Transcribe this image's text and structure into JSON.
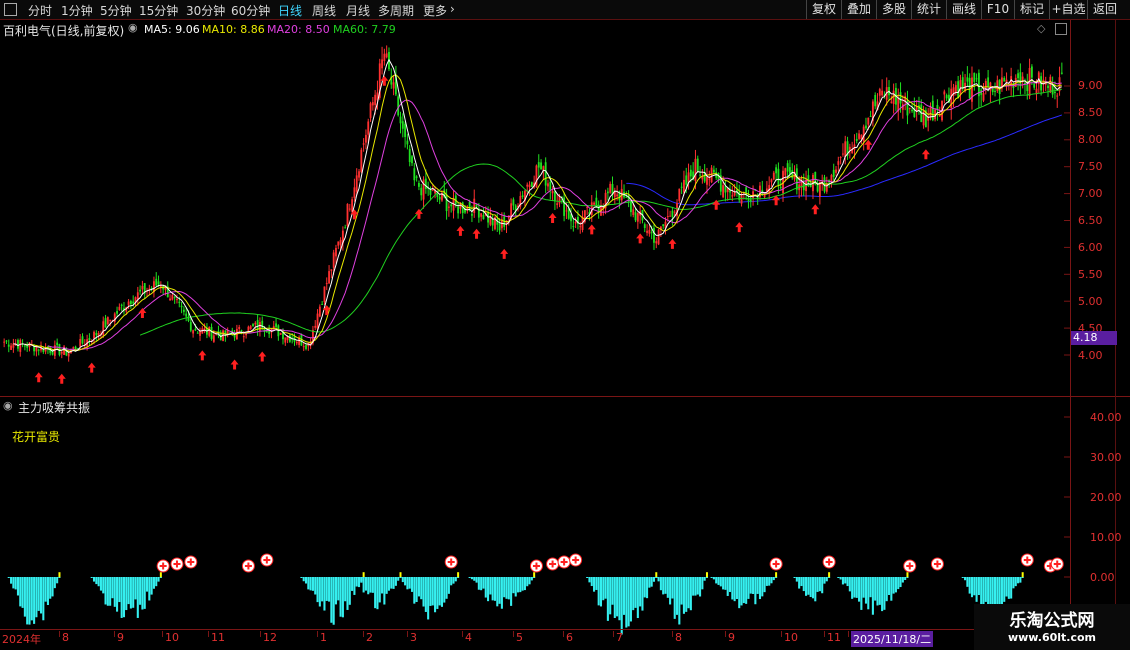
{
  "toolbar": {
    "periods": [
      "分时",
      "1分钟",
      "5分钟",
      "15分钟",
      "30分钟",
      "60分钟",
      "日线",
      "周线",
      "月线",
      "多周期",
      "更多"
    ],
    "active_period": "日线",
    "right_buttons": [
      "复权",
      "叠加",
      "多股",
      "统计",
      "画线",
      "F10",
      "标记",
      "+自选",
      "返回"
    ]
  },
  "main_chart": {
    "stock_title": "百利电气(日线,前复权)",
    "ma5_label": "MA5: 9.06",
    "ma10_label": "MA10: 8.86",
    "ma20_label": "MA20: 8.50",
    "ma60_label": "MA60: 7.79",
    "price_ticks": [
      "9.00",
      "8.50",
      "8.00",
      "7.50",
      "7.00",
      "6.50",
      "6.00",
      "5.50",
      "5.00",
      "4.50",
      "4.00"
    ],
    "low_price_tag": "4.18",
    "colors": {
      "ma5": "#ffffff",
      "ma10": "#e8e800",
      "ma20": "#e040e0",
      "ma60": "#20d020",
      "up": "#ff3030",
      "down": "#20e020",
      "long_ma": "#2a2aff"
    }
  },
  "indicator": {
    "name": "主力吸筹共振",
    "text": "花开富贵",
    "ticks": [
      "40.00",
      "30.00",
      "20.00",
      "10.00",
      "0.00"
    ],
    "bar_color": "#35f0f0"
  },
  "date_axis": {
    "labels": [
      "2024年",
      "8",
      "9",
      "10",
      "11",
      "12",
      "1",
      "2",
      "3",
      "4",
      "5",
      "6",
      "7",
      "8",
      "9",
      "10",
      "11",
      "2025/11/18/二"
    ]
  },
  "watermark": {
    "line1": "乐淘公式网",
    "line2": "www.60lt.com"
  },
  "chart_data": {
    "type": "candlestick",
    "title": "百利电气(日线,前复权)",
    "y_range": [
      3.7,
      10.3
    ],
    "anchors_x_index": [
      0,
      28,
      40,
      55,
      68,
      82,
      95,
      112,
      132,
      148,
      165,
      178,
      195,
      205,
      215,
      232,
      248,
      265,
      283,
      300,
      320,
      338,
      355,
      382,
      400,
      412,
      428,
      440,
      452,
      459
    ],
    "anchors_price": [
      4.25,
      4.05,
      4.4,
      5.05,
      5.35,
      4.5,
      4.35,
      4.55,
      4.2,
      6.5,
      9.6,
      7.2,
      6.75,
      6.75,
      6.35,
      7.5,
      6.4,
      7.1,
      6.15,
      7.5,
      6.95,
      7.3,
      7.15,
      8.9,
      8.4,
      9.0,
      8.9,
      9.2,
      9.0,
      9.06
    ],
    "n_candles": 460,
    "signal_arrow_indices": [
      15,
      25,
      38,
      60,
      86,
      100,
      112,
      140,
      152,
      165,
      180,
      198,
      205,
      217,
      238,
      255,
      276,
      290,
      309,
      319,
      335,
      352,
      375,
      400
    ],
    "indicator_plus_indices": [
      69,
      75,
      81,
      106,
      114,
      194,
      231,
      238,
      243,
      248,
      335,
      358,
      393,
      405,
      444,
      454,
      457
    ]
  }
}
